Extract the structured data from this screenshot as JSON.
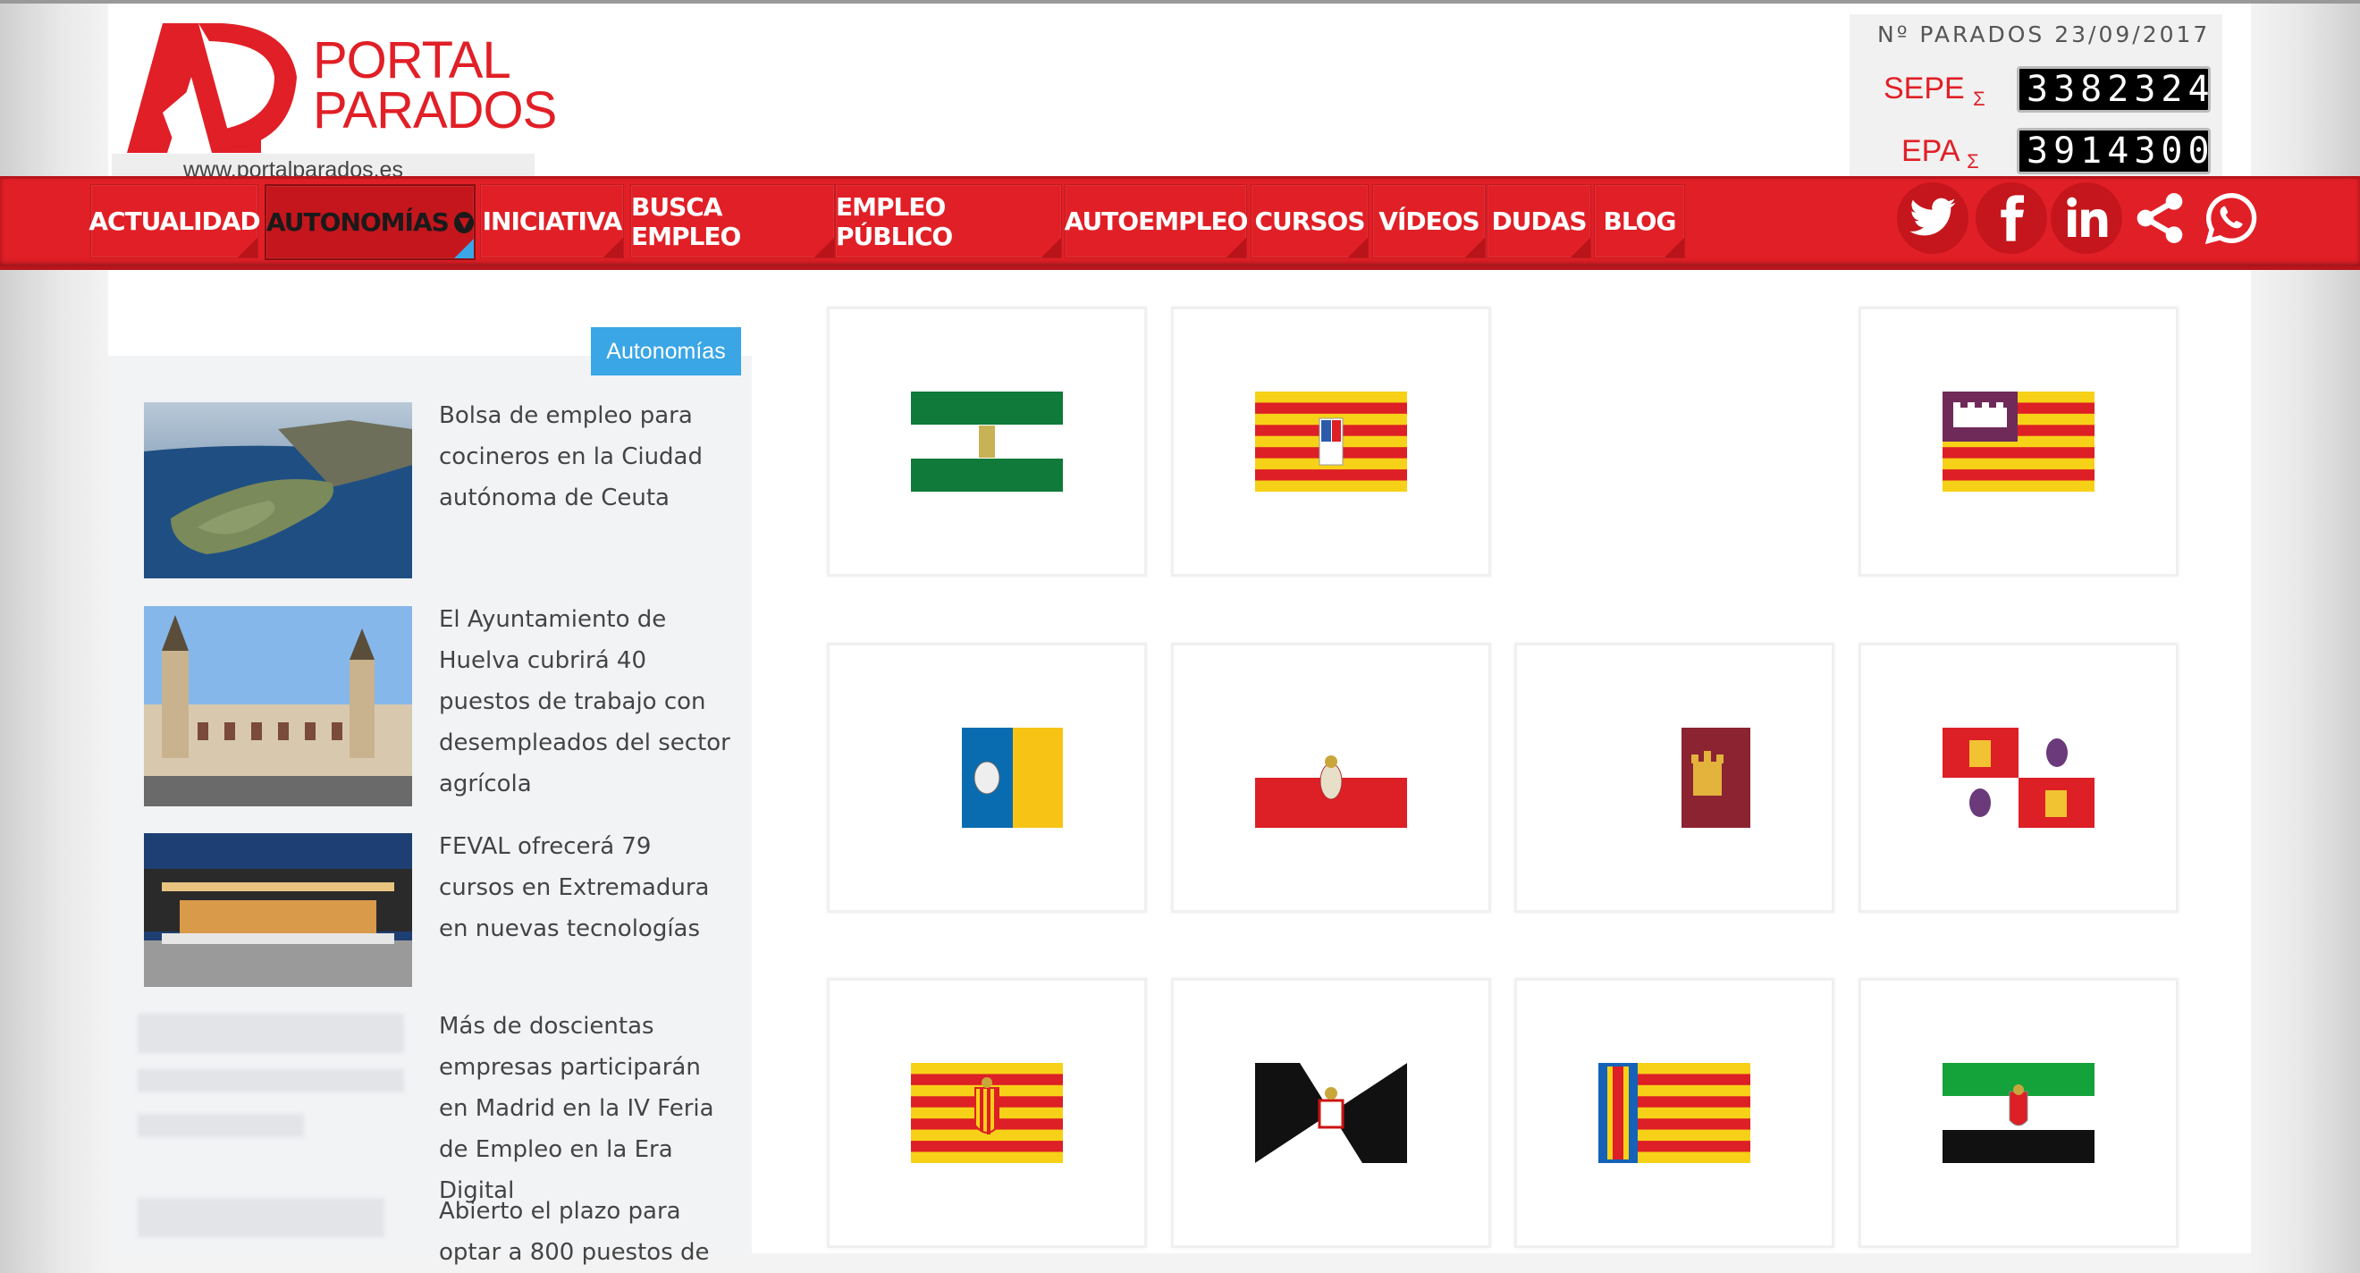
{
  "header": {
    "brand_line1": "PORTAL",
    "brand_line2": "PARADOS",
    "url": "www.portalparados.es"
  },
  "counter": {
    "title_prefix": "Nº PARADOS",
    "date": "23/09/2017",
    "sepe_label": "SEPE",
    "sepe_value": "3382324",
    "epa_label": "EPA",
    "epa_value": "3914300",
    "sigma": "Σ"
  },
  "nav": {
    "items": [
      {
        "label": "ACTUALIDAD"
      },
      {
        "label": "AUTONOMÍAS"
      },
      {
        "label": "INICIATIVA"
      },
      {
        "label": "BUSCA EMPLEO"
      },
      {
        "label": "EMPLEO PÚBLICO"
      },
      {
        "label": "AUTOEMPLEO"
      },
      {
        "label": "CURSOS"
      },
      {
        "label": "VÍDEOS"
      },
      {
        "label": "DUDAS"
      },
      {
        "label": "BLOG"
      }
    ],
    "social": [
      "twitter-icon",
      "facebook-icon",
      "linkedin-icon",
      "share-icon",
      "whatsapp-icon"
    ]
  },
  "sidebar": {
    "tab": "Autonomías",
    "posts": [
      {
        "title": "Bolsa de empleo para cocineros en la Ciudad autónoma de Ceuta"
      },
      {
        "title": "El Ayuntamiento de Huelva cubrirá 40 puestos de trabajo con desempleados del sector agrícola"
      },
      {
        "title": "FEVAL ofrecerá 79 cursos en Extremadura en nuevas tecnologías"
      },
      {
        "title": "Más de doscientas empresas participarán en Madrid en la IV Feria de Empleo en la Era Digital"
      },
      {
        "title": "Abierto el plazo para optar a 800 puestos de"
      }
    ]
  },
  "flags": [
    "andalucia-flag",
    "aragon-flag",
    "empty",
    "baleares-flag",
    "canarias-flag",
    "cantabria-flag",
    "castilla-la-mancha-flag",
    "castilla-y-leon-flag",
    "cataluna-flag",
    "ceuta-flag",
    "valencia-flag",
    "extremadura-flag"
  ],
  "colors": {
    "brand_red": "#e11f26",
    "accent_blue": "#3aa6e6"
  }
}
